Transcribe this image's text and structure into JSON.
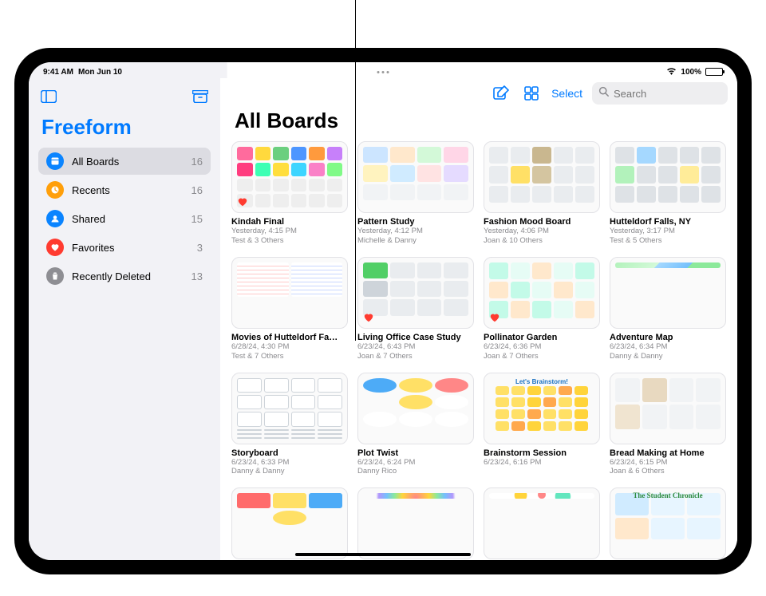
{
  "status": {
    "time": "9:41 AM",
    "date": "Mon Jun 10",
    "battery_pct": "100%"
  },
  "sidebar": {
    "app_title": "Freeform",
    "items": [
      {
        "label": "All Boards",
        "count": "16",
        "icon": "board-icon",
        "color": "#0a84ff",
        "selected": true
      },
      {
        "label": "Recents",
        "count": "16",
        "icon": "clock-icon",
        "color": "#ff9f0a",
        "selected": false
      },
      {
        "label": "Shared",
        "count": "15",
        "icon": "people-icon",
        "color": "#0a84ff",
        "selected": false
      },
      {
        "label": "Favorites",
        "count": "3",
        "icon": "heart-icon",
        "color": "#ff3b30",
        "selected": false
      },
      {
        "label": "Recently Deleted",
        "count": "13",
        "icon": "trash-icon",
        "color": "#8e8e93",
        "selected": false
      }
    ]
  },
  "toolbar": {
    "select_label": "Select",
    "search_placeholder": "Search"
  },
  "main": {
    "title": "All Boards"
  },
  "boards": [
    {
      "title": "Kindah Final",
      "date": "Yesterday, 4:15 PM",
      "people": "Test & 3 Others",
      "fav": true,
      "art": "a1"
    },
    {
      "title": "Pattern Study",
      "date": "Yesterday, 4:12 PM",
      "people": "Michelle & Danny",
      "fav": false,
      "art": "a2"
    },
    {
      "title": "Fashion Mood Board",
      "date": "Yesterday, 4:06 PM",
      "people": "Joan & 10 Others",
      "fav": false,
      "art": "a3"
    },
    {
      "title": "Hutteldorf Falls, NY",
      "date": "Yesterday, 3:17 PM",
      "people": "Test & 5 Others",
      "fav": false,
      "art": "a4"
    },
    {
      "title": "Movies of Hutteldorf Fa…",
      "date": "6/28/24, 4:30 PM",
      "people": "Test & 7 Others",
      "fav": false,
      "art": "a5"
    },
    {
      "title": "Living Office Case Study",
      "date": "6/23/24, 6:43 PM",
      "people": "Joan & 7 Others",
      "fav": true,
      "art": "a6"
    },
    {
      "title": "Pollinator Garden",
      "date": "6/23/24, 6:36 PM",
      "people": "Joan & 7 Others",
      "fav": true,
      "art": "a7"
    },
    {
      "title": "Adventure Map",
      "date": "6/23/24, 6:34 PM",
      "people": "Danny & Danny",
      "fav": false,
      "art": "a8"
    },
    {
      "title": "Storyboard",
      "date": "6/23/24, 6:33 PM",
      "people": "Danny & Danny",
      "fav": false,
      "art": "a9"
    },
    {
      "title": "Plot Twist",
      "date": "6/23/24, 6:24 PM",
      "people": "Danny Rico",
      "fav": false,
      "art": "a10"
    },
    {
      "title": "Brainstorm Session",
      "date": "6/23/24, 6:16 PM",
      "people": "",
      "fav": false,
      "art": "a11",
      "overlay": "Let's Brainstorm!"
    },
    {
      "title": "Bread Making at Home",
      "date": "6/23/24, 6:15 PM",
      "people": "Joan & 6 Others",
      "fav": false,
      "art": "a12"
    },
    {
      "title": "",
      "date": "",
      "people": "",
      "fav": false,
      "art": "a13"
    },
    {
      "title": "",
      "date": "",
      "people": "",
      "fav": false,
      "art": "a14"
    },
    {
      "title": "",
      "date": "",
      "people": "",
      "fav": false,
      "art": "a15"
    },
    {
      "title": "",
      "date": "",
      "people": "",
      "fav": false,
      "art": "a16",
      "overlay2": "The Student Chronicle"
    }
  ]
}
